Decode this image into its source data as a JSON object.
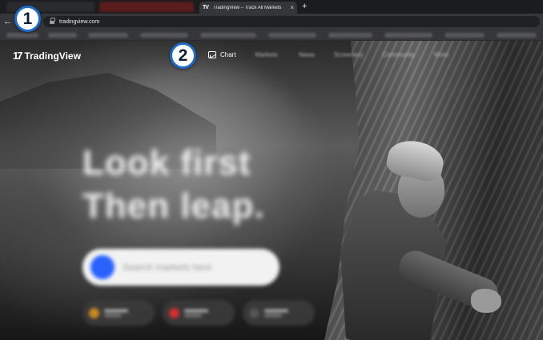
{
  "browser": {
    "active_tab_title": "TradingView – Track All Markets",
    "tab_favicon": "TV",
    "close_glyph": "×",
    "new_tab_glyph": "+",
    "back_glyph": "←",
    "url": "tradingview.com",
    "lock_icon": "lock-icon"
  },
  "site": {
    "logo_mark": "17",
    "logo_text": "TradingView",
    "nav": {
      "chart": "Chart",
      "markets": "Markets",
      "news": "News",
      "screeners": "Screeners",
      "community": "Community",
      "more": "More"
    },
    "hero_line_1": "Look first",
    "hero_line_2": "Then leap.",
    "search_placeholder": "Search markets here",
    "accent_color": "#2962ff"
  },
  "annotations": {
    "badge_1": "1",
    "badge_2": "2",
    "badge_border_color": "#1d6ac7"
  }
}
